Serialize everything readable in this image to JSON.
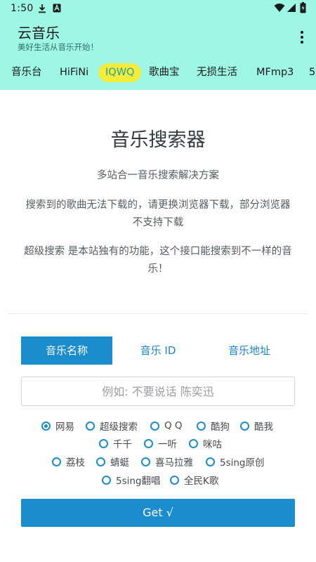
{
  "status_bar": {
    "time": "1:50",
    "icons": [
      "download-icon",
      "a-badge-icon",
      "wifi-icon",
      "signal-icon",
      "battery-icon"
    ]
  },
  "app": {
    "title": "云音乐",
    "subtitle": "美好生活从音乐开始！"
  },
  "tabs": [
    {
      "label": "音乐台"
    },
    {
      "label": "HiFiNi"
    },
    {
      "label": "IQWQ",
      "active": true
    },
    {
      "label": "歌曲宝"
    },
    {
      "label": "无损生活"
    },
    {
      "label": "MFmp3"
    },
    {
      "label": "5"
    }
  ],
  "main": {
    "title": "音乐搜索器",
    "tagline": "多站合一音乐搜索解决方案",
    "notice_line1": "搜索到的歌曲无法下载的，请更换浏览器下载，部分浏览器",
    "notice_line2": "不支持下载",
    "super_line1": "超级搜索 是本站独有的功能，这个接口能搜索到不一样的音",
    "super_line2": "乐！"
  },
  "search_modes": [
    {
      "label": "音乐名称",
      "active": true
    },
    {
      "label": "音乐 ID"
    },
    {
      "label": "音乐地址"
    }
  ],
  "search": {
    "placeholder": "例如: 不要说话 陈奕迅",
    "value": ""
  },
  "sources": [
    {
      "label": "网易",
      "selected": true
    },
    {
      "label": "超级搜索"
    },
    {
      "label": "Q Q"
    },
    {
      "label": "酷狗"
    },
    {
      "label": "酷我"
    },
    {
      "label": "千千"
    },
    {
      "label": "一听"
    },
    {
      "label": "咪咕"
    },
    {
      "label": "荔枝"
    },
    {
      "label": "蜻蜓"
    },
    {
      "label": "喜马拉雅"
    },
    {
      "label": "5sing原创"
    },
    {
      "label": "5sing翻唱"
    },
    {
      "label": "全民K歌"
    }
  ],
  "get_button": {
    "label": "Get √"
  },
  "colors": {
    "header_bg": "#9ef6e4",
    "active_tab_bg": "#f3ec3c",
    "active_tab_text": "#1aa39a",
    "primary": "#1b8ccd"
  }
}
